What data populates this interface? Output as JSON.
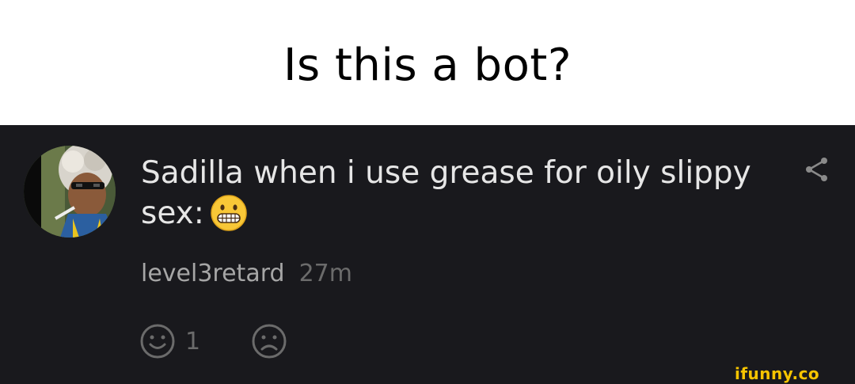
{
  "caption": {
    "title": "Is this a bot?"
  },
  "comment": {
    "text": "Sadilla when i use grease for oily slippy sex:",
    "emoji_icon": "grimacing-face-emoji",
    "username": "level3retard",
    "time": "27m",
    "share_icon": "share-icon",
    "reactions": {
      "smile_icon": "smile-icon",
      "smile_count": "1",
      "frown_icon": "frown-icon"
    }
  },
  "watermark": "ifunny.co",
  "colors": {
    "background": "#19191d",
    "text": "#e6e6e6",
    "username": "#a6a6a6",
    "muted": "#6b6b6b",
    "watermark": "#f6c400"
  }
}
